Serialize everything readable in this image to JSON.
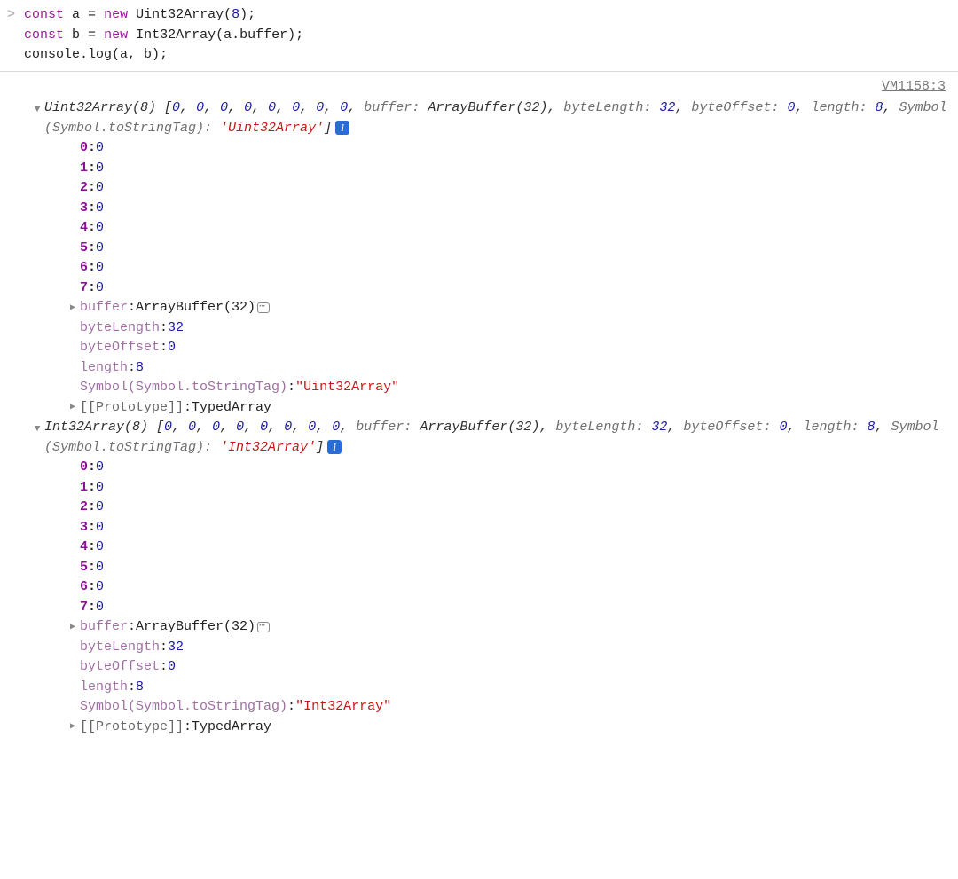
{
  "input": {
    "line1_kw1": "const",
    "line1_var": " a ",
    "line1_eq": "=",
    "line1_new": " new",
    "line1_cls": " Uint32Array(",
    "line1_arg": "8",
    "line1_end": ");",
    "line2_kw1": "const",
    "line2_var": " b ",
    "line2_eq": "=",
    "line2_new": " new",
    "line2_cls": " Int32Array(a",
    "line2_dot": ".",
    "line2_buf": "buffer);",
    "line3": "console.log(a, b);"
  },
  "source_link": "VM1158:3",
  "objects": [
    {
      "summary_cls": "Uint32Array(8) ",
      "summary_open": "[",
      "summary_vals": [
        "0",
        "0",
        "0",
        "0",
        "0",
        "0",
        "0",
        "0"
      ],
      "summary_extra": [
        {
          "k": "buffer",
          "v": "ArrayBuffer(32)",
          "type": "obj"
        },
        {
          "k": "byteLength",
          "v": "32",
          "type": "num"
        },
        {
          "k": "byteOffset",
          "v": "0",
          "type": "num"
        },
        {
          "k": "length",
          "v": "8",
          "type": "num"
        },
        {
          "k": "Symbol(Symbol.toStringTag)",
          "v": "'Uint32Array'",
          "type": "str"
        }
      ],
      "summary_close": "]",
      "index_props": [
        {
          "k": "0",
          "v": "0"
        },
        {
          "k": "1",
          "v": "0"
        },
        {
          "k": "2",
          "v": "0"
        },
        {
          "k": "3",
          "v": "0"
        },
        {
          "k": "4",
          "v": "0"
        },
        {
          "k": "5",
          "v": "0"
        },
        {
          "k": "6",
          "v": "0"
        },
        {
          "k": "7",
          "v": "0"
        }
      ],
      "named_props": [
        {
          "tri": true,
          "key": "buffer",
          "keystyle": "dim",
          "val": "ArrayBuffer(32)",
          "valtype": "obj",
          "mem": true
        },
        {
          "tri": false,
          "key": "byteLength",
          "keystyle": "dim",
          "val": "32",
          "valtype": "num"
        },
        {
          "tri": false,
          "key": "byteOffset",
          "keystyle": "dim",
          "val": "0",
          "valtype": "num"
        },
        {
          "tri": false,
          "key": "length",
          "keystyle": "dim",
          "val": "8",
          "valtype": "num"
        },
        {
          "tri": false,
          "key": "Symbol(Symbol.toStringTag)",
          "keystyle": "dim",
          "val": "\"Uint32Array\"",
          "valtype": "str"
        },
        {
          "tri": true,
          "key": "[[Prototype]]",
          "keystyle": "internal",
          "val": "TypedArray",
          "valtype": "obj"
        }
      ]
    },
    {
      "summary_cls": "Int32Array(8) ",
      "summary_open": "[",
      "summary_vals": [
        "0",
        "0",
        "0",
        "0",
        "0",
        "0",
        "0",
        "0"
      ],
      "summary_extra": [
        {
          "k": "buffer",
          "v": "ArrayBuffer(32)",
          "type": "obj"
        },
        {
          "k": "byteLength",
          "v": "32",
          "type": "num"
        },
        {
          "k": "byteOffset",
          "v": "0",
          "type": "num"
        },
        {
          "k": "length",
          "v": "8",
          "type": "num"
        },
        {
          "k": "Symbol(Symbol.toStringTag)",
          "v": "'Int32Array'",
          "type": "str"
        }
      ],
      "summary_close": "]",
      "index_props": [
        {
          "k": "0",
          "v": "0"
        },
        {
          "k": "1",
          "v": "0"
        },
        {
          "k": "2",
          "v": "0"
        },
        {
          "k": "3",
          "v": "0"
        },
        {
          "k": "4",
          "v": "0"
        },
        {
          "k": "5",
          "v": "0"
        },
        {
          "k": "6",
          "v": "0"
        },
        {
          "k": "7",
          "v": "0"
        }
      ],
      "named_props": [
        {
          "tri": true,
          "key": "buffer",
          "keystyle": "dim",
          "val": "ArrayBuffer(32)",
          "valtype": "obj",
          "mem": true
        },
        {
          "tri": false,
          "key": "byteLength",
          "keystyle": "dim",
          "val": "32",
          "valtype": "num"
        },
        {
          "tri": false,
          "key": "byteOffset",
          "keystyle": "dim",
          "val": "0",
          "valtype": "num"
        },
        {
          "tri": false,
          "key": "length",
          "keystyle": "dim",
          "val": "8",
          "valtype": "num"
        },
        {
          "tri": false,
          "key": "Symbol(Symbol.toStringTag)",
          "keystyle": "dim",
          "val": "\"Int32Array\"",
          "valtype": "str"
        },
        {
          "tri": true,
          "key": "[[Prototype]]",
          "keystyle": "internal",
          "val": "TypedArray",
          "valtype": "obj"
        }
      ]
    }
  ]
}
